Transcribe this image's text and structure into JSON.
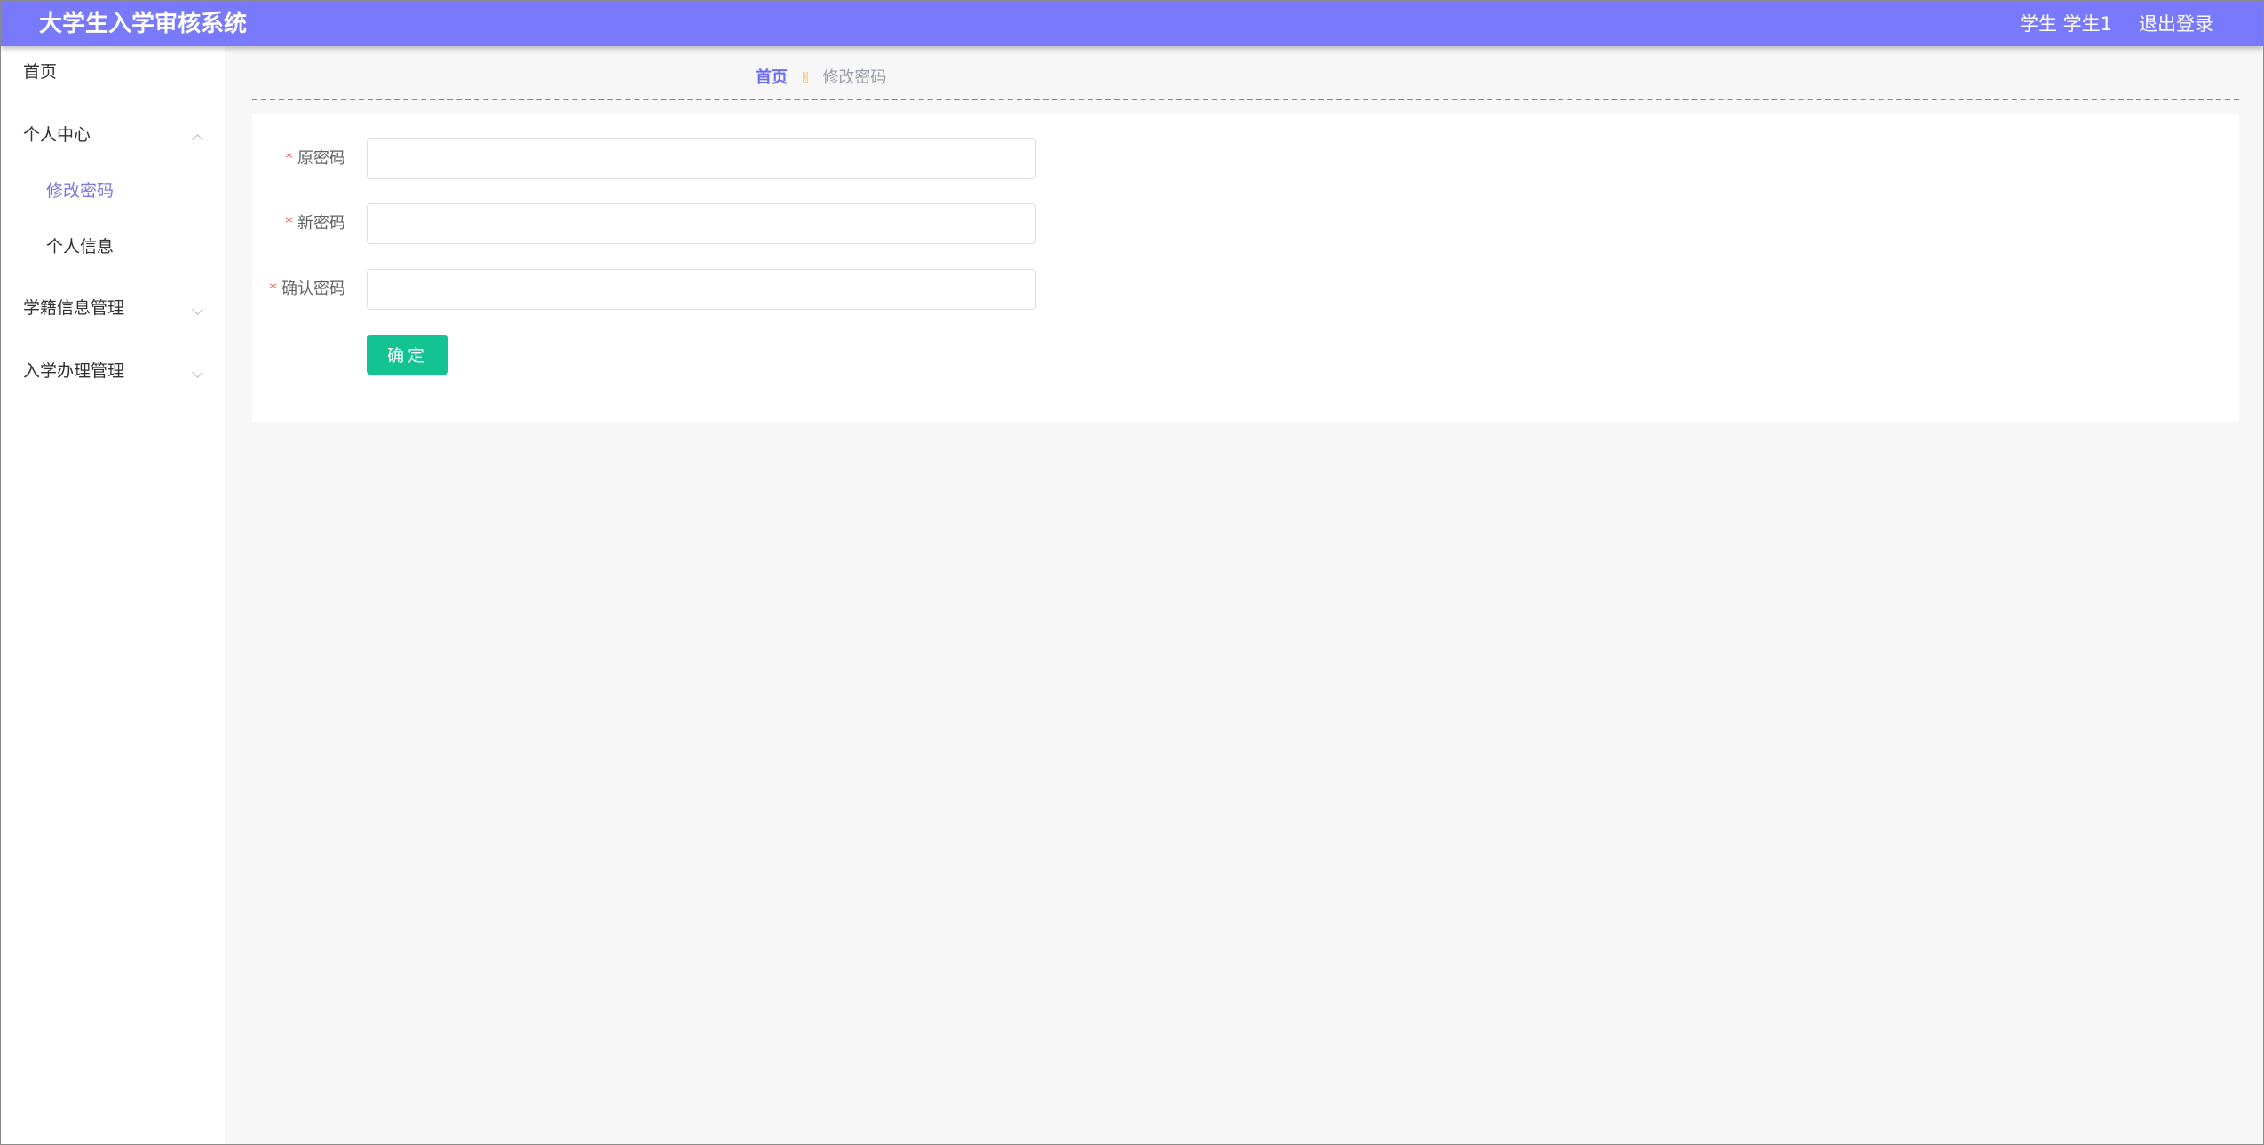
{
  "header": {
    "title": "大学生入学审核系统",
    "user_label": "学生 学生1",
    "logout_label": "退出登录"
  },
  "sidebar": {
    "items": [
      {
        "label": "首页"
      },
      {
        "label": "个人中心",
        "expanded": true,
        "children": [
          {
            "label": "修改密码",
            "active": true
          },
          {
            "label": "个人信息"
          }
        ]
      },
      {
        "label": "学籍信息管理",
        "expanded": false
      },
      {
        "label": "入学办理管理",
        "expanded": false
      }
    ]
  },
  "breadcrumb": {
    "home": "首页",
    "separator_icon": "victory-hand-icon",
    "current": "修改密码"
  },
  "form": {
    "fields": [
      {
        "label": "原密码",
        "required": true,
        "value": "",
        "placeholder": ""
      },
      {
        "label": "新密码",
        "required": true,
        "value": "",
        "placeholder": ""
      },
      {
        "label": "确认密码",
        "required": true,
        "value": "",
        "placeholder": ""
      }
    ],
    "submit_label": "确定"
  },
  "colors": {
    "header_bg": "#7979fb",
    "accent": "#6c6cf0",
    "button_bg": "#13c391",
    "required": "#f56c6c"
  }
}
